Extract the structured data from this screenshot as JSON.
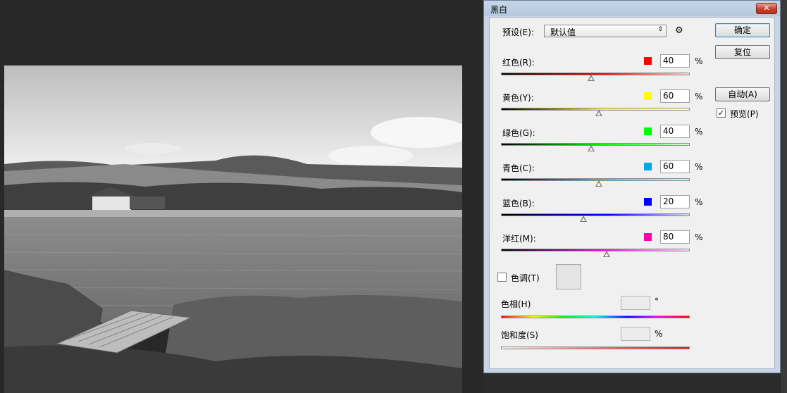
{
  "dialog": {
    "title": "黑白",
    "close_icon": "close-x-icon",
    "preset_label": "预设(E):",
    "preset_value": "默认值",
    "settings_icon": "gear-icon",
    "buttons": {
      "ok": "确定",
      "reset": "复位",
      "auto": "自动(A)"
    },
    "preview": {
      "label": "预览(P)",
      "checked": true
    },
    "channels": [
      {
        "label": "红色(R):",
        "value": "40",
        "unit": "%",
        "swatch": "#ff0000"
      },
      {
        "label": "黄色(Y):",
        "value": "60",
        "unit": "%",
        "swatch": "#ffff00"
      },
      {
        "label": "绿色(G):",
        "value": "40",
        "unit": "%",
        "swatch": "#00ff00"
      },
      {
        "label": "青色(C):",
        "value": "60",
        "unit": "%",
        "swatch": "#00a8e6"
      },
      {
        "label": "蓝色(B):",
        "value": "20",
        "unit": "%",
        "swatch": "#0000ff"
      },
      {
        "label": "洋红(M):",
        "value": "80",
        "unit": "%",
        "swatch": "#ff00aa"
      }
    ],
    "tint": {
      "label": "色调(T)",
      "checked": false
    },
    "hue": {
      "label": "色相(H)",
      "value": "",
      "unit": "°"
    },
    "saturation": {
      "label": "饱和度(S)",
      "value": "",
      "unit": "%"
    }
  }
}
